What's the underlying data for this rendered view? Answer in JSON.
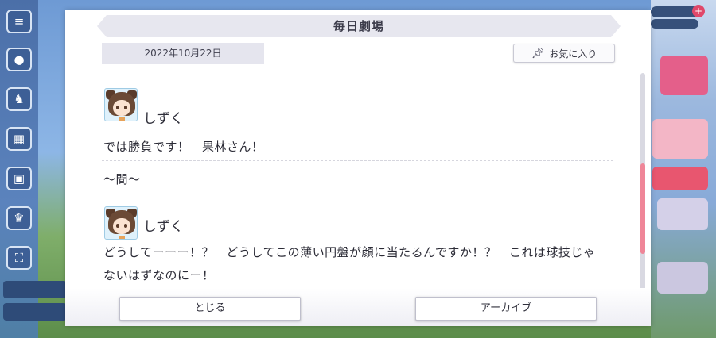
{
  "dialog": {
    "title": "毎日劇場",
    "date": "2022年10月22日",
    "favorite_label": "お気に入り",
    "entries": [
      {
        "speaker": "しずく",
        "text": "では勝負です！　果林さん！"
      },
      {
        "narration": "〜間〜"
      },
      {
        "speaker": "しずく",
        "text_line1": "どうしてーーー！？　どうしてこの薄い円盤が顔に当たるんですか！？　これは球技じゃ",
        "text_line2": "ないはずなのにー！"
      }
    ],
    "buttons": {
      "close": "とじる",
      "archive": "アーカイブ"
    }
  },
  "colors": {
    "accent_scroll": "#ef8698",
    "title_bar": "#e7e7ef"
  },
  "icons": {
    "favorite": "pin-icon"
  }
}
